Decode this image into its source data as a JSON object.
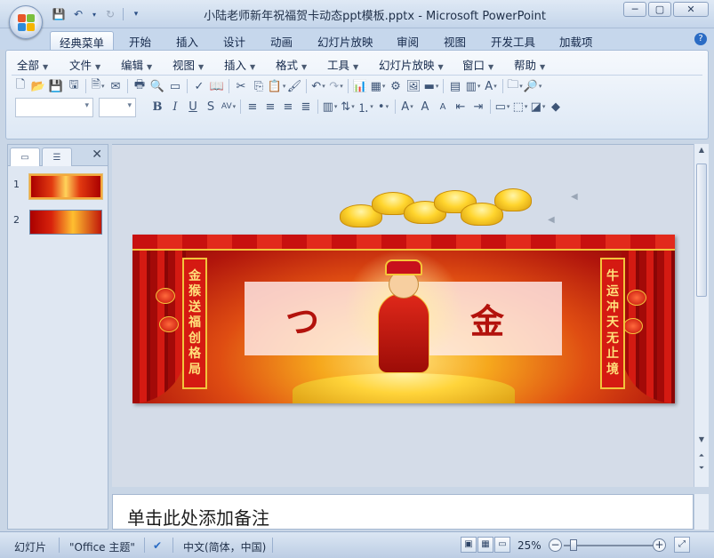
{
  "window": {
    "title": "小陆老师新年祝福贺卡动态ppt模板.pptx - Microsoft PowerPoint",
    "minimize_glyph": "─",
    "maximize_glyph": "▢",
    "close_glyph": "✕"
  },
  "ribbon_tabs": [
    "经典菜单",
    "开始",
    "插入",
    "设计",
    "动画",
    "幻灯片放映",
    "审阅",
    "视图",
    "开发工具",
    "加载项"
  ],
  "classic_menu": [
    "全部",
    "文件",
    "编辑",
    "视图",
    "插入",
    "格式",
    "工具",
    "幻灯片放映",
    "窗口",
    "帮助"
  ],
  "left_pane": {
    "tabs": [
      "slides-tab",
      "outline-tab"
    ],
    "close_glyph": "✕",
    "slides": [
      {
        "number": "1"
      },
      {
        "number": "2"
      }
    ]
  },
  "slide": {
    "banner_left": [
      "金",
      "猴",
      "送",
      "福",
      "创",
      "格",
      "局"
    ],
    "banner_right": [
      "牛",
      "运",
      "冲",
      "天",
      "无",
      "止",
      "境"
    ],
    "textbox_char_left": "つ",
    "textbox_char_right": "金"
  },
  "notes": {
    "placeholder": "单击此处添加备注"
  },
  "statusbar": {
    "slide_label": "幻灯片",
    "theme": "\"Office 主题\"",
    "language": "中文(简体，中国)",
    "zoom": "25%"
  },
  "colors": {
    "accent": "#2b6cc4",
    "slide_red": "#c8100f",
    "gold": "#f2c43c"
  }
}
